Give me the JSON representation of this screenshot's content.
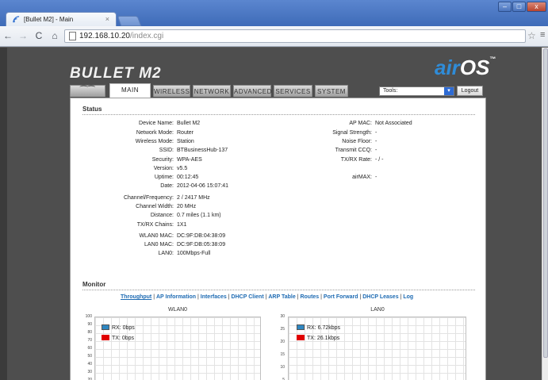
{
  "browser": {
    "tab_title": "[Bullet M2] - Main",
    "tab_close": "×",
    "url_host": "192.168.10.20",
    "url_path": "/index.cgi",
    "window_buttons": {
      "minimize": "–",
      "maximize": "□",
      "close": "x"
    }
  },
  "header": {
    "product_logo": "BULLET M2",
    "airos_air": "air",
    "airos_os": "OS",
    "airos_tm": "™"
  },
  "tabs": [
    {
      "label": "",
      "icon": "ubiquiti-logo-icon"
    },
    {
      "label": "MAIN",
      "active": true
    },
    {
      "label": "WIRELESS"
    },
    {
      "label": "NETWORK"
    },
    {
      "label": "ADVANCED"
    },
    {
      "label": "SERVICES"
    },
    {
      "label": "SYSTEM"
    }
  ],
  "tools": {
    "selected": "Tools:",
    "arrow": "▾"
  },
  "logout_label": "Logout",
  "status": {
    "title": "Status",
    "left": [
      {
        "k": "Device Name:",
        "v": "Bullet M2"
      },
      {
        "k": "Network Mode:",
        "v": "Router"
      },
      {
        "k": "Wireless Mode:",
        "v": "Station"
      },
      {
        "k": "SSID:",
        "v": "BTBusinessHub-137"
      },
      {
        "k": "Security:",
        "v": "WPA-AES"
      },
      {
        "k": "Version:",
        "v": "v5.5"
      },
      {
        "k": "Uptime:",
        "v": "00:12:45"
      },
      {
        "k": "Date:",
        "v": "2012-04-06 15:07:41"
      },
      {
        "k": "Channel/Frequency:",
        "v": "2 / 2417 MHz"
      },
      {
        "k": "Channel Width:",
        "v": "20 MHz"
      },
      {
        "k": "Distance:",
        "v": "0.7 miles (1.1 km)"
      },
      {
        "k": "TX/RX Chains:",
        "v": "1X1"
      },
      {
        "k": "WLAN0 MAC:",
        "v": "DC:9F:DB:04:38:09"
      },
      {
        "k": "LAN0 MAC:",
        "v": "DC:9F:DB:05:38:09"
      },
      {
        "k": "LAN0:",
        "v": "100Mbps-Full"
      }
    ],
    "right": [
      {
        "k": "AP MAC:",
        "v": "Not Associated"
      },
      {
        "k": "Signal Strength:",
        "v": "-"
      },
      {
        "k": "Noise Floor:",
        "v": "-"
      },
      {
        "k": "Transmit CCQ:",
        "v": "-"
      },
      {
        "k": "TX/RX Rate:",
        "v": "- / -"
      },
      {
        "k": "airMAX:",
        "v": "-"
      }
    ]
  },
  "monitor": {
    "title": "Monitor",
    "links": [
      "Throughput",
      "AP Information",
      "Interfaces",
      "DHCP Client",
      "ARP Table",
      "Routes",
      "Port Forward",
      "DHCP Leases",
      "Log"
    ],
    "active_link": "Throughput"
  },
  "charts": {
    "wlan0": {
      "title": "WLAN0",
      "yticks": [
        "100",
        "90",
        "80",
        "70",
        "60",
        "50",
        "40",
        "30",
        "20"
      ],
      "rx": "RX: 0bps",
      "tx": "TX: 0bps"
    },
    "lan0": {
      "title": "LAN0",
      "yticks": [
        "30",
        "25",
        "20",
        "15",
        "10",
        "5"
      ],
      "rx": "RX: 6.72kbps",
      "tx": "TX: 26.1kbps"
    }
  },
  "colors": {
    "rx": "#2e86c1",
    "tx": "#e00000",
    "link": "#1e6bb3",
    "airos_accent": "#2f8cd8"
  }
}
